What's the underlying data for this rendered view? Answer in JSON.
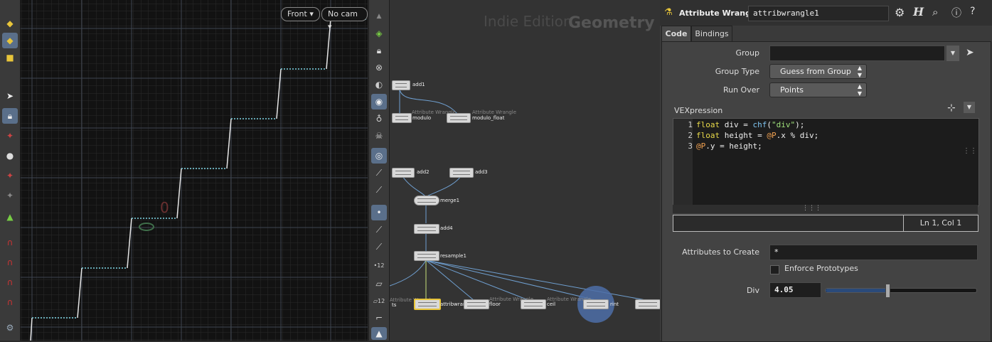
{
  "viewport": {
    "view_menu": "Front",
    "camera_menu": "No cam",
    "overlay_text": "0"
  },
  "network": {
    "edition": "Indie Edition",
    "context": "Geometry",
    "nodes": {
      "add1": "add1",
      "modulo": "modulo",
      "modulo_float": "modulo_float",
      "add2": "add2",
      "add3": "add3",
      "merge1": "merge1",
      "add4": "add4",
      "resample1": "resample1",
      "ts": "ts",
      "attribwrangle": "attribwran",
      "floor": "floor",
      "ceil": "ceil",
      "rint": "rint"
    },
    "type_label": "Attribute Wrangle"
  },
  "params": {
    "node_type": "Attribute Wrangle",
    "node_name": "attribwrangle1",
    "tabs": [
      "Code",
      "Bindings"
    ],
    "group_label": "Group",
    "group_value": "",
    "group_type_label": "Group Type",
    "group_type_value": "Guess from Group",
    "run_over_label": "Run Over",
    "run_over_value": "Points",
    "vex_label": "VEXpression",
    "code_lines": [
      "1",
      "2",
      "3"
    ],
    "cursor_status": "Ln 1, Col 1",
    "attrs_label": "Attributes to Create",
    "attrs_value": "*",
    "enforce_label": "Enforce Prototypes",
    "div_label": "Div",
    "div_value": "4.05",
    "div_slider_fraction": 0.41
  }
}
